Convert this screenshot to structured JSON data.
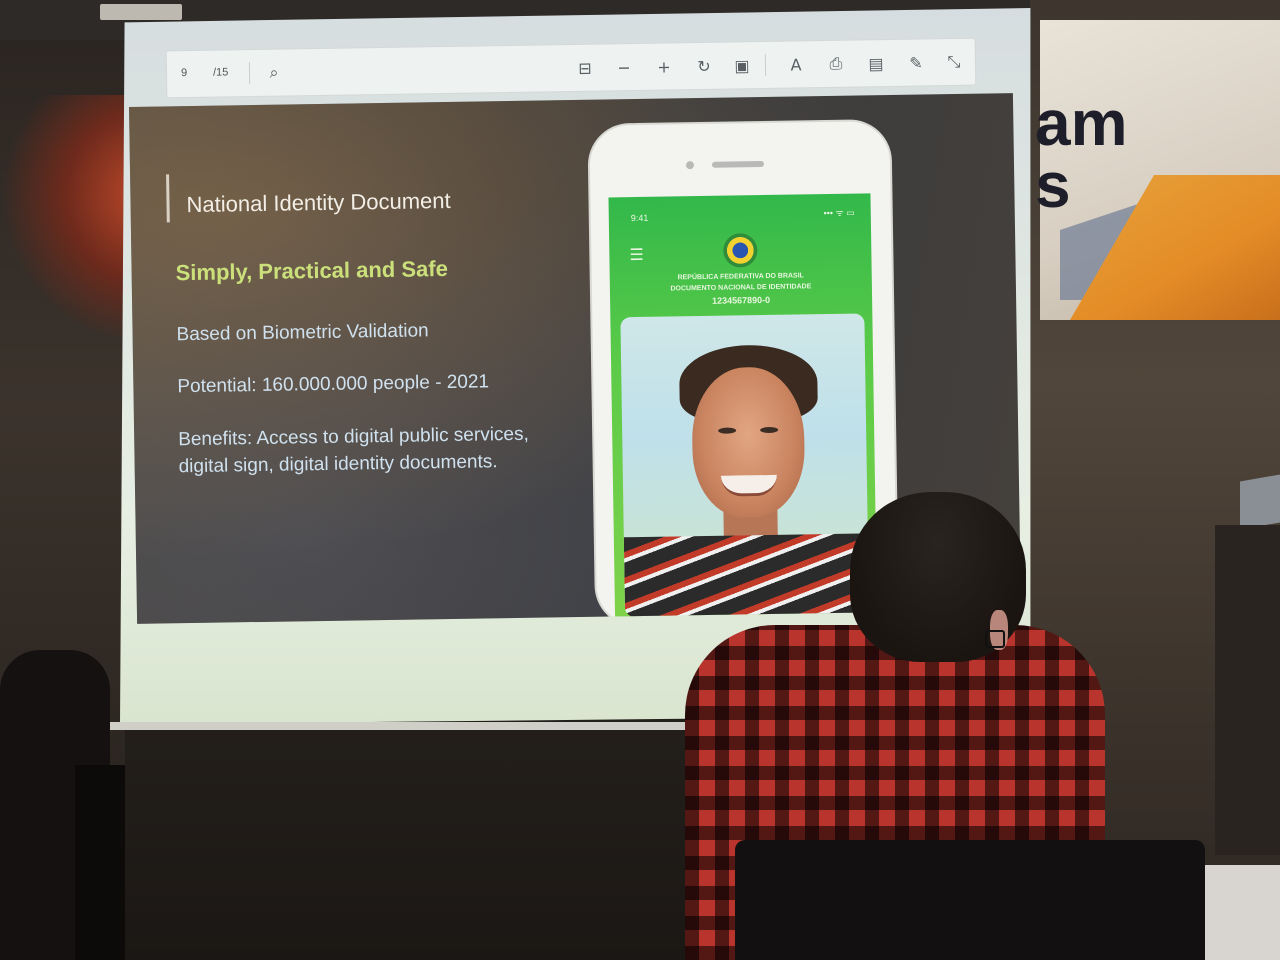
{
  "viewer_toolbar": {
    "current_page": "9",
    "total_pages": "/15",
    "icons": [
      "search-icon",
      "fit-page-icon",
      "zoom-out-icon",
      "zoom-in-icon",
      "rotate-icon",
      "page-view-icon",
      "read-aloud-icon",
      "print-icon",
      "save-icon",
      "annotate-icon",
      "exit-fullscreen-icon"
    ]
  },
  "slide": {
    "title": "National Identity Document",
    "subtitle": "Simply, Practical and Safe",
    "bullets": [
      "Based on Biometric Validation",
      "Potential: 160.000.000 people - 2021",
      "Benefits: Access to digital public services, digital sign, digital identity documents."
    ]
  },
  "phone": {
    "time": "9:41",
    "status": "••• ᯤ ▭",
    "menu": "☰",
    "line1": "REPÚBLICA FEDERATIVA DO BRASIL",
    "line2": "DOCUMENTO NACIONAL DE IDENTIDADE",
    "id_number": "1234567890-0"
  },
  "background_banner": {
    "text_line1": "am",
    "text_line2": "s"
  }
}
